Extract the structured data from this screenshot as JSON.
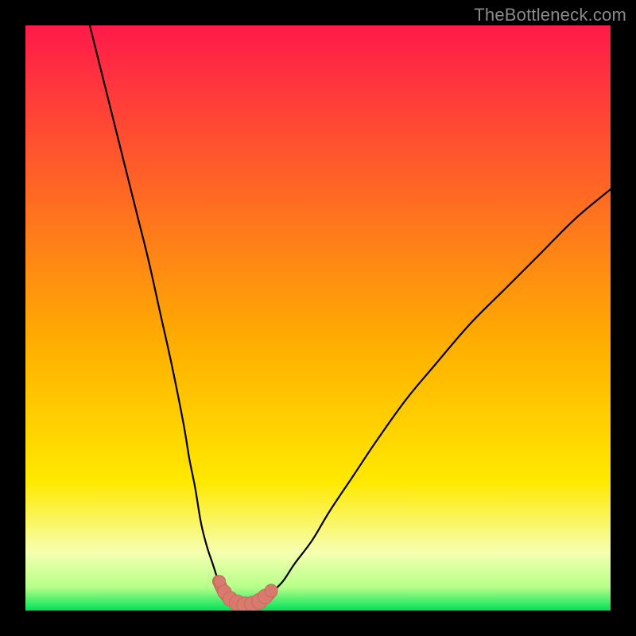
{
  "watermark": "TheBottleneck.com",
  "colors": {
    "frame_bg": "#000000",
    "gradient_top": "#ff1a4a",
    "gradient_yellow": "#ffe900",
    "gradient_pale": "#f6ffb0",
    "gradient_green": "#00e25a",
    "curve": "#000000",
    "marker_body": "#d87a6d",
    "marker_stroke": "#c86a5e"
  },
  "chart_data": {
    "type": "line",
    "title": "",
    "xlabel": "",
    "ylabel": "",
    "xlim": [
      0,
      100
    ],
    "ylim": [
      0,
      100
    ],
    "series": [
      {
        "name": "left-curve",
        "x": [
          11,
          13,
          15,
          17,
          19,
          21,
          23,
          25,
          27,
          28,
          29,
          30,
          31,
          32,
          33,
          34,
          35
        ],
        "y": [
          100,
          92,
          84,
          76,
          68,
          60,
          51,
          42,
          32,
          26,
          21,
          15,
          11,
          8,
          5,
          3,
          2
        ]
      },
      {
        "name": "right-curve",
        "x": [
          41,
          42,
          44,
          46,
          49,
          52,
          56,
          60,
          65,
          70,
          76,
          82,
          88,
          94,
          100
        ],
        "y": [
          2,
          3,
          5,
          8,
          12,
          17,
          23,
          29,
          36,
          42,
          49,
          55,
          61,
          67,
          72
        ]
      },
      {
        "name": "bottom-band",
        "x": [
          33,
          34,
          35,
          36,
          37,
          38,
          39,
          40,
          41,
          42
        ],
        "y": [
          5,
          3,
          2,
          1.2,
          1,
          1,
          1.2,
          1.6,
          2.2,
          3.2
        ]
      }
    ],
    "markers": [
      {
        "x": 33.2,
        "y": 5.0,
        "r": 1.1
      },
      {
        "x": 34.0,
        "y": 3.2,
        "r": 1.3
      },
      {
        "x": 35.0,
        "y": 2.0,
        "r": 1.4
      },
      {
        "x": 36.2,
        "y": 1.3,
        "r": 1.5
      },
      {
        "x": 37.5,
        "y": 1.0,
        "r": 1.5
      },
      {
        "x": 38.8,
        "y": 1.1,
        "r": 1.5
      },
      {
        "x": 40.0,
        "y": 1.6,
        "r": 1.5
      },
      {
        "x": 41.0,
        "y": 2.4,
        "r": 1.4
      },
      {
        "x": 42.0,
        "y": 3.4,
        "r": 1.2
      }
    ]
  }
}
